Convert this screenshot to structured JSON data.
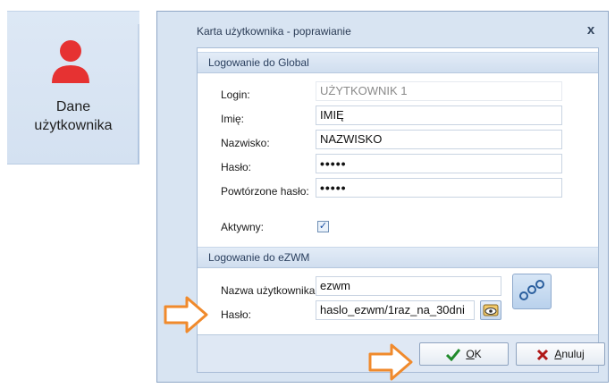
{
  "ribbon": {
    "label_line1": "Dane",
    "label_line2": "użytkownika",
    "icon": "user-icon",
    "icon_color": "#e63232"
  },
  "dialog": {
    "title": "Karta użytkownika - poprawianie",
    "close_label": "x",
    "global_section": {
      "title": "Logowanie do Global",
      "login_label": "Login:",
      "login_value": "UŻYTKOWNIK 1",
      "first_name_label": "Imię:",
      "first_name_value": "IMIĘ",
      "last_name_label": "Nazwisko:",
      "last_name_value": "NAZWISKO",
      "password_label": "Hasło:",
      "password_value": "•••••",
      "repeat_password_label": "Powtórzone hasło:",
      "repeat_password_value": "•••••",
      "active_label": "Aktywny:",
      "active_checked": true
    },
    "ezwm_section": {
      "title": "Logowanie do eZWM",
      "username_label": "Nazwa użytkownika",
      "username_value": "ezwm",
      "password_label": "Hasło:",
      "password_value": "haslo_ezwm/1raz_na_30dni",
      "link_icon": "link-chain-icon",
      "show_password_icon": "eye-icon"
    },
    "buttons": {
      "ok_label_underlined": "O",
      "ok_label_rest": "K",
      "cancel_label_underlined": "A",
      "cancel_label_rest": "nuluj"
    }
  },
  "colors": {
    "accent_arrow": "#f08a2c",
    "ok_check": "#1f8a2b",
    "cancel_x": "#b01818"
  }
}
